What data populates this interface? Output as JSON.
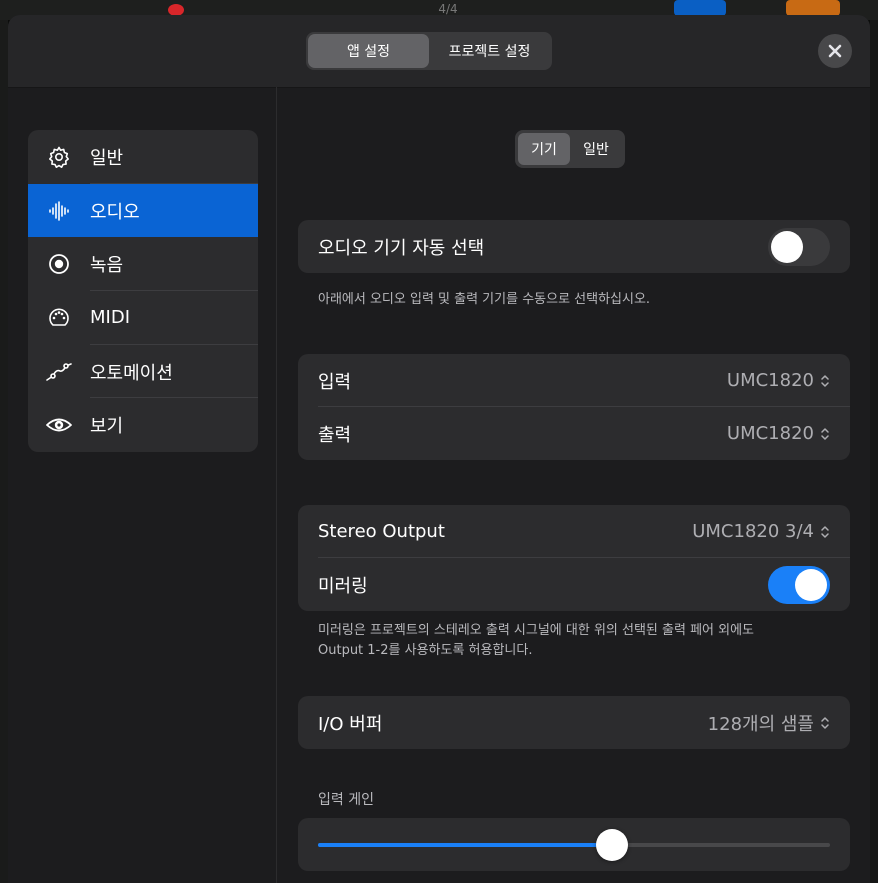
{
  "header": {
    "tabs": [
      {
        "label": "앱 설정",
        "active": true
      },
      {
        "label": "프로젝트 설정",
        "active": false
      }
    ],
    "close_icon": "close-icon",
    "background_time_signature": "4/4"
  },
  "sidebar": {
    "items": [
      {
        "label": "일반",
        "icon": "gear-icon",
        "active": false
      },
      {
        "label": "오디오",
        "icon": "waveform-icon",
        "active": true
      },
      {
        "label": "녹음",
        "icon": "record-icon",
        "active": false
      },
      {
        "label": "MIDI",
        "icon": "midi-connector-icon",
        "active": false
      },
      {
        "label": "오토메이션",
        "icon": "automation-curve-icon",
        "active": false
      },
      {
        "label": "보기",
        "icon": "eye-icon",
        "active": false
      }
    ]
  },
  "subtabs": [
    {
      "label": "기기",
      "active": true
    },
    {
      "label": "일반",
      "active": false
    }
  ],
  "auto_select": {
    "label": "오디오 기기 자동 선택",
    "enabled": false,
    "footnote": "아래에서 오디오 입력 및 출력 기기를 수동으로 선택하십시오."
  },
  "devices": {
    "input_label": "입력",
    "input_value": "UMC1820",
    "output_label": "출력",
    "output_value": "UMC1820"
  },
  "stereo": {
    "label": "Stereo Output",
    "value": "UMC1820 3/4",
    "mirroring_label": "미러링",
    "mirroring_enabled": true,
    "footnote_line1": "미러링은 프로젝트의 스테레오 출력 시그널에 대한 위의 선택된 출력 페어 외에도",
    "footnote_line2": "Output 1-2를 사용하도록 허용합니다."
  },
  "buffer": {
    "label": "I/O 버퍼",
    "value": "128개의 샘플"
  },
  "input_gain": {
    "label": "입력 게인",
    "level_fraction": 0.575
  },
  "colors": {
    "accent": "#0a64d4",
    "toggle_on": "#1a80f8",
    "panel": "#1c1c1e",
    "group": "#2c2c2e"
  }
}
